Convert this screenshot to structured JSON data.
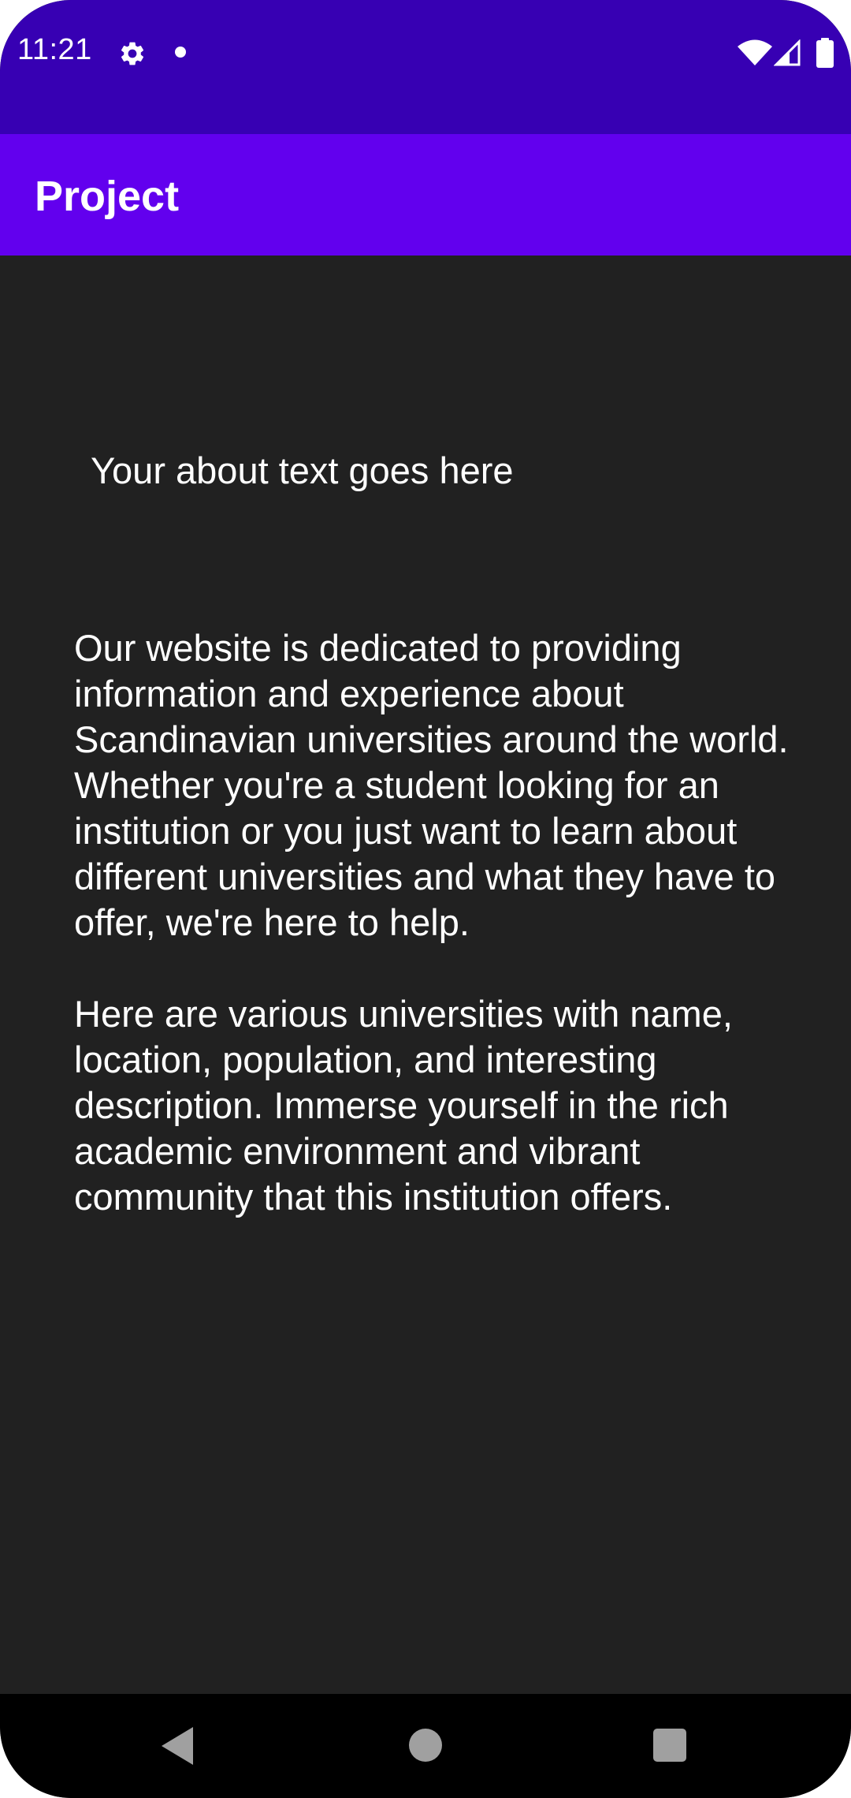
{
  "status_bar": {
    "time": "11:21",
    "icons": [
      "gear-icon",
      "notification-dot-icon",
      "wifi-icon",
      "signal-icon",
      "battery-icon"
    ]
  },
  "app_bar": {
    "title": "Project"
  },
  "content": {
    "heading": "Your about text goes here",
    "paragraphs": [
      "Our website is dedicated to providing information and experience about Scandinavian universities around the world. Whether you're a student looking for an institution or you just want to learn about different universities and what they have to offer, we're here to help.",
      "Here are various universities with name, location, population, and interesting description. Immerse yourself in the rich academic environment and vibrant community that this institution offers."
    ]
  },
  "nav_bar": {
    "icons": [
      "back-icon",
      "home-icon",
      "recents-icon"
    ]
  },
  "colors": {
    "status_bar": "#3700b3",
    "app_bar": "#6200ee",
    "background": "#212121",
    "nav_bar": "#000000",
    "text": "#ffffff"
  }
}
